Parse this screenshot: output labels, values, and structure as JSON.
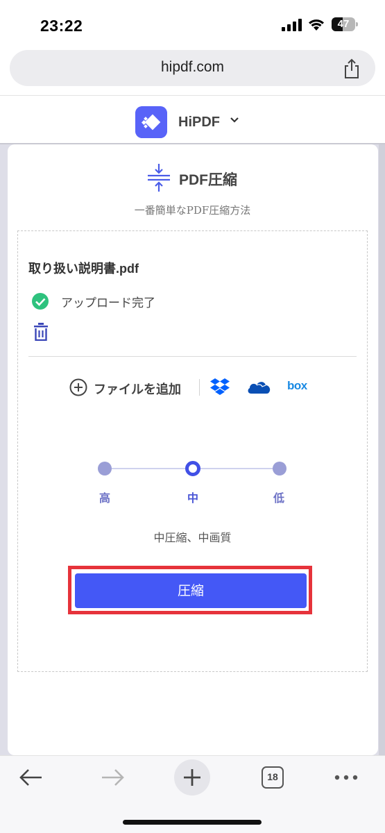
{
  "status_bar": {
    "time": "23:22",
    "battery_percent": 47,
    "battery_label": "47"
  },
  "browser": {
    "url": "hipdf.com",
    "tab_count": "18"
  },
  "site": {
    "brand": "HiPDF"
  },
  "tool": {
    "title": "PDF圧縮",
    "subtitle": "一番簡単なPDF圧縮方法"
  },
  "file": {
    "name": "取り扱い説明書.pdf",
    "status": "アップロード完了"
  },
  "add_files": {
    "label": "ファイルを追加",
    "sources": [
      "dropbox-icon",
      "onedrive-icon",
      "box"
    ],
    "box_label": "box"
  },
  "compression": {
    "levels": [
      "高",
      "中",
      "低"
    ],
    "selected": "中",
    "description": "中圧縮、中画質"
  },
  "compress_button": {
    "label": "圧縮"
  },
  "colors": {
    "accent": "#4458f6",
    "success": "#2ec27e",
    "highlight": "#e6333b"
  }
}
